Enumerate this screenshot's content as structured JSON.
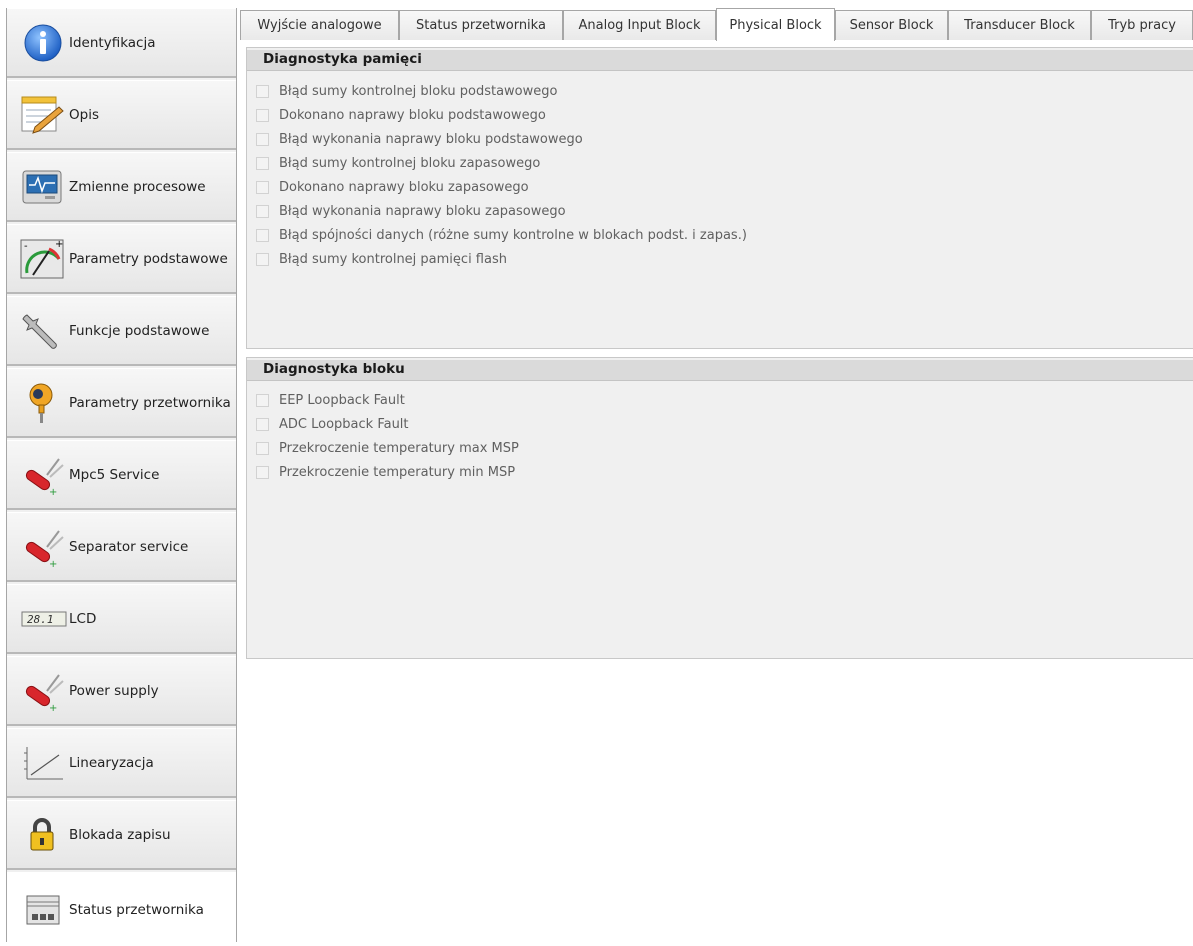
{
  "sidebar": {
    "items": [
      {
        "label": "Identyfikacja",
        "icon": "info-icon"
      },
      {
        "label": "Opis",
        "icon": "notepad-icon"
      },
      {
        "label": "Zmienne procesowe",
        "icon": "monitor-icon"
      },
      {
        "label": "Parametry podstawowe",
        "icon": "gauge-icon"
      },
      {
        "label": "Funkcje podstawowe",
        "icon": "wrench-icon"
      },
      {
        "label": "Parametry przetwornika",
        "icon": "transmitter-icon"
      },
      {
        "label": "Mpc5 Service",
        "icon": "service-tool-icon"
      },
      {
        "label": "Separator service",
        "icon": "service-tool-icon"
      },
      {
        "label": "LCD",
        "icon": "lcd-icon"
      },
      {
        "label": "Power supply",
        "icon": "service-tool-icon"
      },
      {
        "label": "Linearyzacja",
        "icon": "chart-line-icon"
      },
      {
        "label": "Blokada zapisu",
        "icon": "padlock-icon"
      },
      {
        "label": "Status przetwornika",
        "icon": "status-panel-icon"
      }
    ],
    "active_index": 12
  },
  "tabs": [
    {
      "label": "Wyjście analogowe"
    },
    {
      "label": "Status przetwornika"
    },
    {
      "label": "Analog Input Block"
    },
    {
      "label": "Physical Block"
    },
    {
      "label": "Sensor Block"
    },
    {
      "label": "Transducer Block"
    },
    {
      "label": "Tryb pracy"
    }
  ],
  "active_tab": "Physical Block",
  "memory_diagnostics": {
    "title": "Diagnostyka pamięci",
    "items": [
      {
        "label": "Błąd sumy kontrolnej bloku podstawowego",
        "checked": false
      },
      {
        "label": "Dokonano naprawy bloku podstawowego",
        "checked": false
      },
      {
        "label": "Błąd wykonania naprawy bloku podstawowego",
        "checked": false
      },
      {
        "label": "Błąd sumy kontrolnej bloku zapasowego",
        "checked": false
      },
      {
        "label": "Dokonano naprawy bloku zapasowego",
        "checked": false
      },
      {
        "label": "Błąd wykonania naprawy bloku zapasowego",
        "checked": false
      },
      {
        "label": "Błąd spójności danych (różne sumy kontrolne w blokach podst. i zapas.)",
        "checked": false
      },
      {
        "label": "Błąd sumy kontrolnej pamięci flash",
        "checked": false
      }
    ]
  },
  "block_diagnostics": {
    "title": "Diagnostyka bloku",
    "items": [
      {
        "label": "EEP Loopback Fault",
        "checked": false
      },
      {
        "label": "ADC Loopback Fault",
        "checked": false
      },
      {
        "label": "Przekroczenie temperatury max MSP",
        "checked": false
      },
      {
        "label": "Przekroczenie temperatury min MSP",
        "checked": false
      }
    ]
  },
  "lcd_icon_text": "28.1",
  "colors": {
    "info_blue": "#3a7fd5",
    "active_tab_bg": "#ffffff",
    "group_header_bg": "#dadada",
    "disabled_text": "#606060"
  }
}
